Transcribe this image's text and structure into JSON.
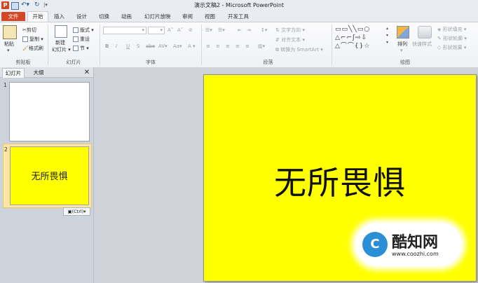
{
  "window": {
    "title": "演示文稿2 - Microsoft PowerPoint",
    "app_icon_letter": "P"
  },
  "tabs": [
    "文件",
    "开始",
    "插入",
    "设计",
    "切换",
    "动画",
    "幻灯片放映",
    "审阅",
    "视图",
    "开发工具"
  ],
  "ribbon": {
    "clipboard": {
      "paste": "粘贴",
      "cut": "剪切",
      "copy": "复制",
      "format_painter": "格式刷",
      "label": "剪贴板"
    },
    "slides": {
      "new_slide": "新建",
      "new_slide_sub": "幻灯片",
      "layout": "版式",
      "reset": "重设",
      "section": "节",
      "label": "幻灯片"
    },
    "font": {
      "label": "字体",
      "bold": "B",
      "italic": "I",
      "underline": "U",
      "strike": "S",
      "shadow": "abe"
    },
    "paragraph": {
      "text_direction": "文字方向",
      "align_text": "对齐文本",
      "smartart": "转换为 SmartArt",
      "label": "段落"
    },
    "drawing": {
      "arrange": "排列",
      "quick_styles": "快速样式",
      "shape_fill": "形状填充",
      "shape_outline": "形状轮廓",
      "shape_effects": "形状效果",
      "label": "绘图"
    }
  },
  "panel": {
    "tab_slides": "幻灯片",
    "tab_outline": "大纲",
    "close": "✕",
    "slide_numbers": [
      "1",
      "2"
    ],
    "thumb2_text": "无所畏惧",
    "paste_options": "(Ctrl)"
  },
  "slide": {
    "text": "无所畏惧",
    "background": "#ffff00"
  },
  "watermark": {
    "logo_letter": "C",
    "name": "酷知网",
    "url": "www.coozhi.com"
  }
}
